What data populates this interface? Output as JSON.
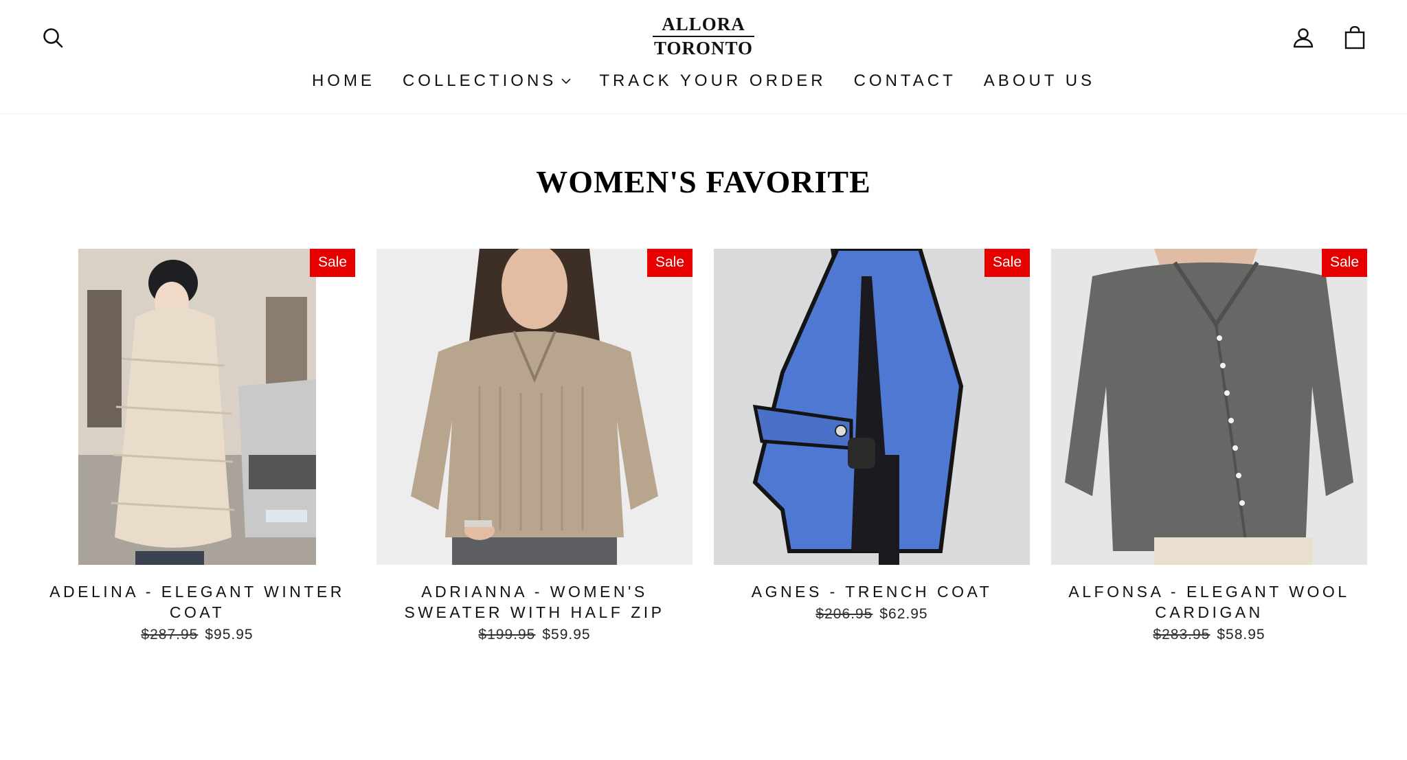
{
  "header": {
    "logo_line1": "ALLORA",
    "logo_line2": "TORONTO",
    "icons": {
      "search": "search-icon",
      "account": "user-icon",
      "cart": "shopping-bag-icon"
    }
  },
  "nav": {
    "home": "HOME",
    "collections": "COLLECTIONS",
    "track": "TRACK YOUR ORDER",
    "contact": "CONTACT",
    "about": "ABOUT US"
  },
  "section": {
    "title": "WOMEN'S FAVORITE"
  },
  "products": [
    {
      "name": "ADELINA - ELEGANT WINTER COAT",
      "badge": "Sale",
      "old_price": "$287.95",
      "price": "$95.95"
    },
    {
      "name": "ADRIANNA - WOMEN'S SWEATER WITH HALF ZIP",
      "badge": "Sale",
      "old_price": "$199.95",
      "price": "$59.95"
    },
    {
      "name": "AGNES - TRENCH COAT",
      "badge": "Sale",
      "old_price": "$206.95",
      "price": "$62.95"
    },
    {
      "name": "ALFONSA - ELEGANT WOOL CARDIGAN",
      "badge": "Sale",
      "old_price": "$283.95",
      "price": "$58.95"
    }
  ],
  "colors": {
    "sale_badge": "#e60000",
    "text": "#111111",
    "background": "#ffffff"
  }
}
